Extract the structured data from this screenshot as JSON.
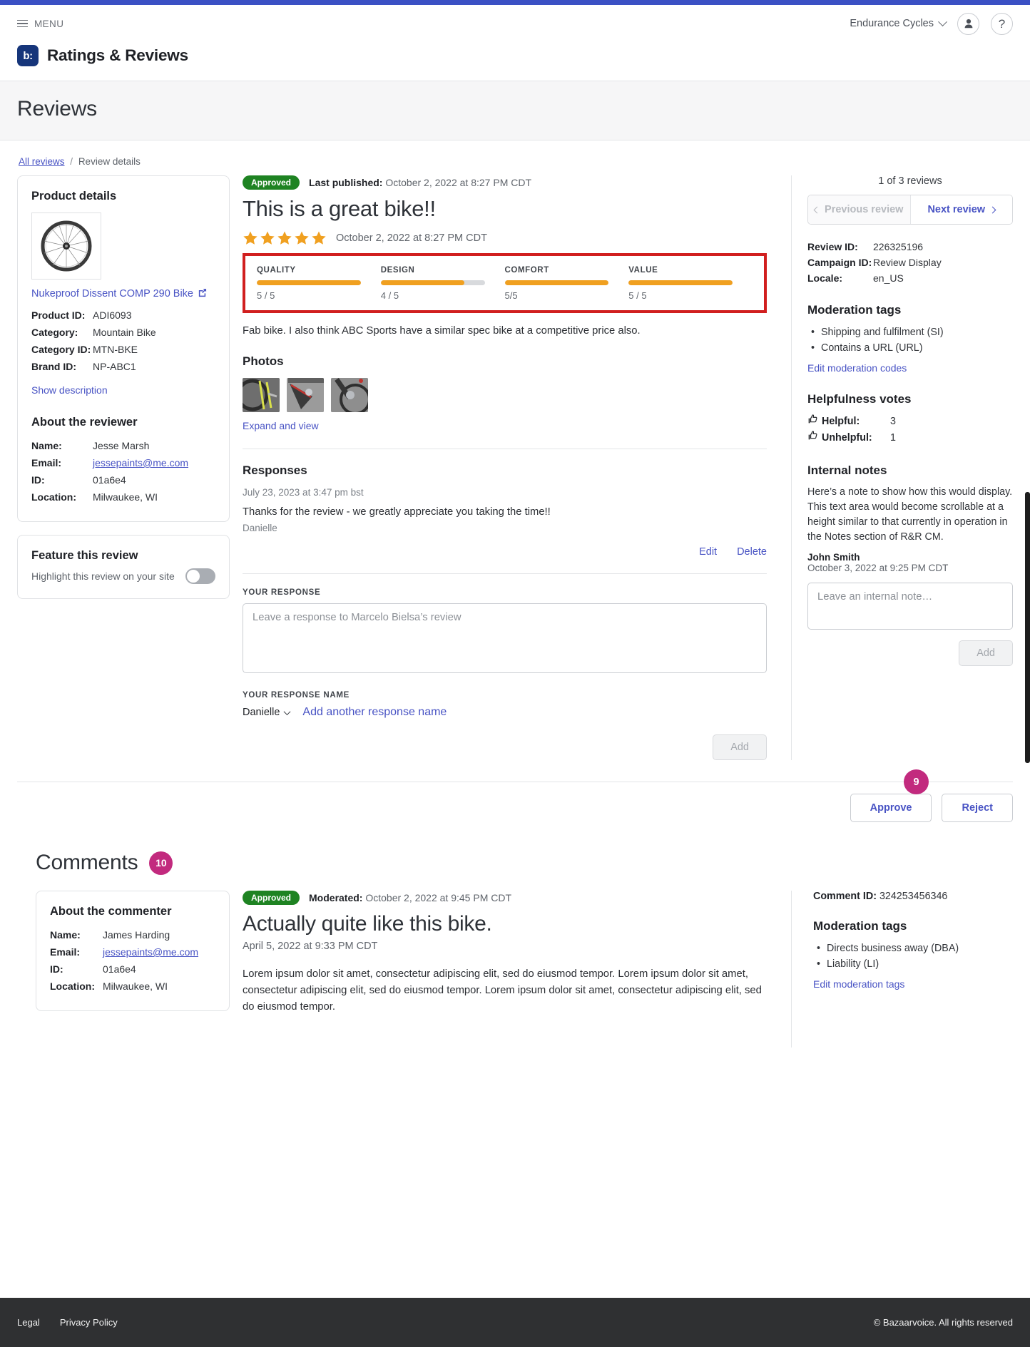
{
  "header": {
    "menu_label": "MENU",
    "org_name": "Endurance Cycles",
    "brand_mark": "b:",
    "brand_name": "Ratings & Reviews",
    "account_icon": "user-icon",
    "help_icon": "question-mark-icon"
  },
  "page": {
    "title": "Reviews",
    "breadcrumb_root": "All reviews",
    "breadcrumb_sep": "/",
    "breadcrumb_current": "Review details"
  },
  "product": {
    "card_title": "Product details",
    "link_text": "Nukeproof Dissent COMP 290 Bike",
    "rows": [
      {
        "key": "Product ID:",
        "value": "ADI6093"
      },
      {
        "key": "Category:",
        "value": "Mountain Bike"
      },
      {
        "key": "Category ID:",
        "value": "MTN-BKE"
      },
      {
        "key": "Brand ID:",
        "value": "NP-ABC1"
      }
    ],
    "show_description": "Show description"
  },
  "reviewer": {
    "card_title": "About the reviewer",
    "name_key": "Name:",
    "name_value": "Jesse Marsh",
    "email_key": "Email:",
    "email_value": "jessepaints@me.com",
    "id_key": "ID:",
    "id_value": "01a6e4",
    "location_key": "Location:",
    "location_value": "Milwaukee, WI"
  },
  "feature": {
    "card_title": "Feature this review",
    "toggle_label": "Highlight this review on your site",
    "toggle_state": "off"
  },
  "review": {
    "status": "Approved",
    "published_label": "Last published:",
    "published_date": "October 2, 2022 at 8:27 PM CDT",
    "title": "This is a great bike!!",
    "star_rating": 5,
    "review_date": "October 2, 2022 at 8:27 PM CDT",
    "secondary_ratings": [
      {
        "label": "QUALITY",
        "value": "5 / 5",
        "fill": 100
      },
      {
        "label": "DESIGN",
        "value": "4 / 5",
        "fill": 80
      },
      {
        "label": "COMFORT",
        "value": "5/5",
        "fill": 100
      },
      {
        "label": "VALUE",
        "value": "5 / 5",
        "fill": 100
      }
    ],
    "body": "Fab bike. I also think ABC Sports have a similar spec bike at a competitive price also.",
    "photos_heading": "Photos",
    "photos_count": 3,
    "expand_link": "Expand and view"
  },
  "responses": {
    "heading": "Responses",
    "date": "July 23, 2023 at 3:47 pm bst",
    "text": "Thanks for the review - we greatly appreciate you taking the time!!",
    "author": "Danielle",
    "edit_label": "Edit",
    "delete_label": "Delete",
    "response_label": "YOUR RESPONSE",
    "response_placeholder": "Leave a response to Marcelo Bielsa’s review",
    "response_value": "",
    "name_label": "YOUR RESPONSE NAME",
    "selected_name": "Danielle",
    "add_name_link": "Add another response name",
    "add_button": "Add"
  },
  "review_meta": {
    "count_text": "1 of 3 reviews",
    "prev_label": "Previous review",
    "next_label": "Next review",
    "rows": [
      {
        "key": "Review ID:",
        "value": "226325196"
      },
      {
        "key": "Campaign ID:",
        "value": "Review Display"
      },
      {
        "key": "Locale:",
        "value": "en_US"
      }
    ],
    "moderation_heading": "Moderation tags",
    "moderation_tags": [
      "Shipping and fulfilment (SI)",
      "Contains a URL (URL)"
    ],
    "edit_codes_link": "Edit moderation codes",
    "votes_heading": "Helpfulness votes",
    "helpful_key": "Helpful:",
    "helpful_value": "3",
    "unhelpful_key": "Unhelpful:",
    "unhelpful_value": "1",
    "notes_heading": "Internal notes",
    "note_text": "Here’s a note to show how this would display. This text area would become scrollable at a height similar to that currently in operation in the Notes section of R&R CM.",
    "note_author": "John Smith",
    "note_date": "October 3, 2022 at 9:25 PM CDT",
    "note_placeholder": "Leave an internal note…",
    "note_value": "",
    "note_add_button": "Add"
  },
  "moderation_actions": {
    "badge_count": "9",
    "approve_label": "Approve",
    "reject_label": "Reject"
  },
  "comments": {
    "heading": "Comments",
    "count": "10",
    "commenter_card_title": "About the commenter",
    "commenter_name_key": "Name:",
    "commenter_name_value": "James Harding",
    "commenter_email_key": "Email:",
    "commenter_email_value": "jessepaints@me.com",
    "commenter_id_key": "ID:",
    "commenter_id_value": "01a6e4",
    "commenter_location_key": "Location:",
    "commenter_location_value": "Milwaukee, WI",
    "status": "Approved",
    "moderated_label": "Moderated:",
    "moderated_date": "October 2, 2022 at 9:45 PM CDT",
    "title": "Actually quite like this bike.",
    "date": "April 5, 2022 at 9:33 PM CDT",
    "body": "Lorem ipsum dolor sit amet, consectetur adipiscing elit, sed do eiusmod tempor. Lorem ipsum dolor sit amet, consectetur adipiscing elit, sed do eiusmod tempor. Lorem ipsum dolor sit amet, consectetur adipiscing elit, sed do eiusmod tempor.",
    "comment_id_key": "Comment ID:",
    "comment_id_value": "324253456346",
    "moderation_heading": "Moderation tags",
    "moderation_tags": [
      "Directs business away (DBA)",
      "Liability (LI)"
    ],
    "edit_tags_link": "Edit moderation tags"
  },
  "footer": {
    "legal": "Legal",
    "privacy": "Privacy Policy",
    "copyright": "© Bazaarvoice. All rights reserved"
  },
  "colors": {
    "accent_blue": "#3b50c4",
    "link_blue": "#4853c4",
    "approved_green": "#1e8322",
    "badge_pink": "#c22a7e",
    "star_orange": "#f0a020",
    "highlight_red": "#d11f1f"
  }
}
